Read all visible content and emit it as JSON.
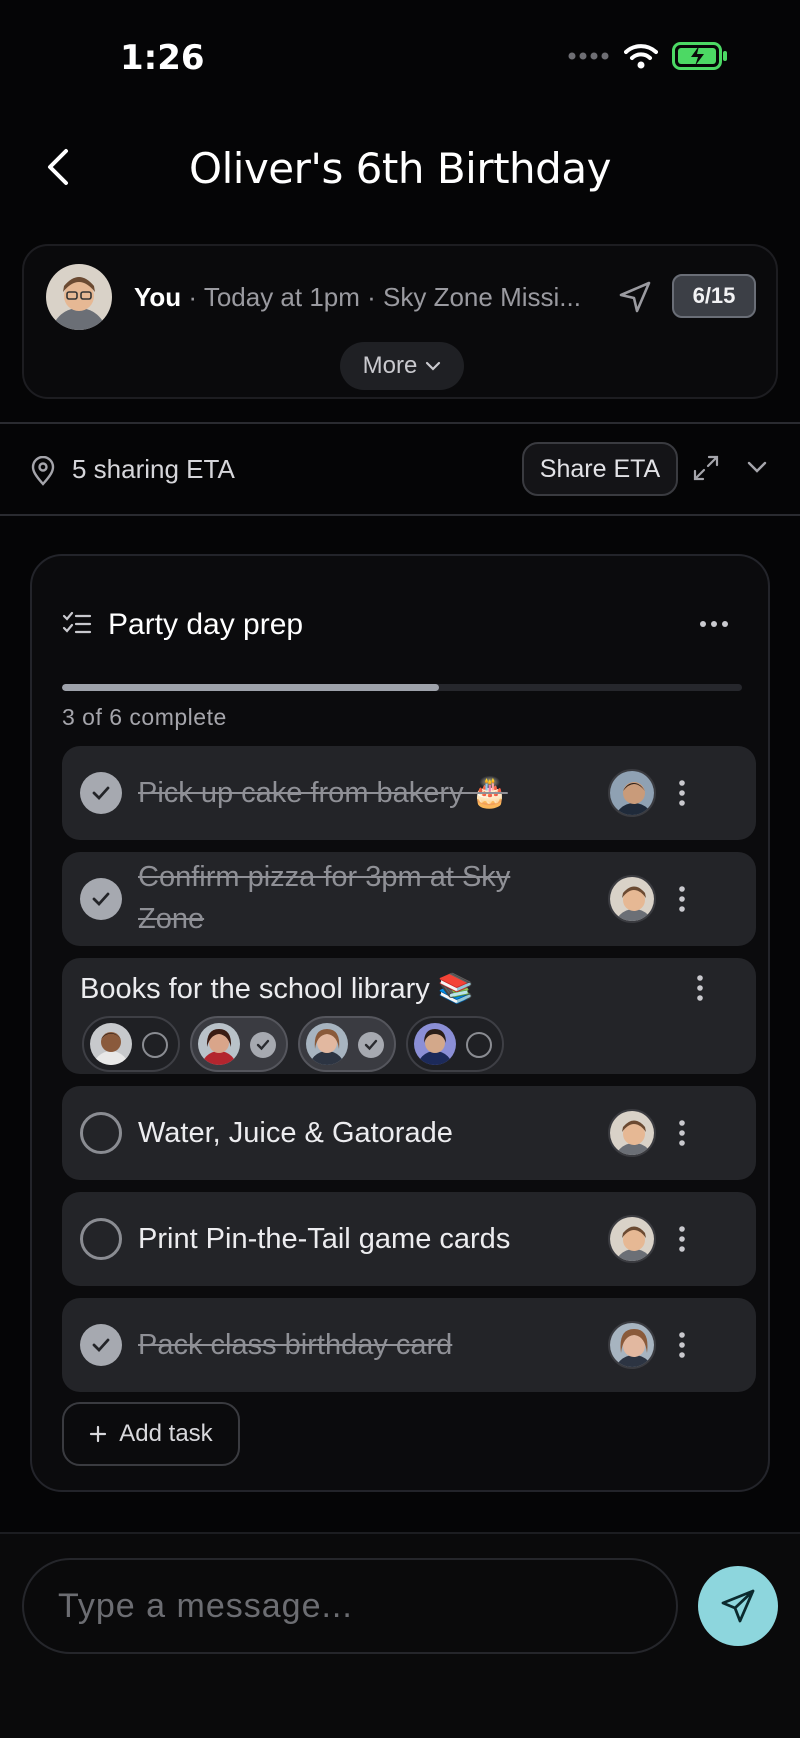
{
  "status": {
    "time": "1:26"
  },
  "header": {
    "title": "Oliver's 6th Birthday"
  },
  "event": {
    "who": "You",
    "details": " · Today at 1pm · Sky Zone Missi...",
    "count": "6/15",
    "more_label": "More"
  },
  "eta": {
    "label": "5 sharing ETA",
    "share_label": "Share ETA"
  },
  "checklist": {
    "title": "Party day prep",
    "progress_label": "3 of 6 complete",
    "progress_fraction": 0.555,
    "tasks": [
      {
        "text": "Pick up cake from bakery 🎂",
        "done": true
      },
      {
        "text": "Confirm pizza for 3pm at Sky Zone",
        "done": true
      },
      {
        "text": "Books for the school library 📚",
        "done": false
      },
      {
        "text": "Water, Juice & Gatorade",
        "done": false
      },
      {
        "text": "Print Pin-the-Tail game cards",
        "done": false
      },
      {
        "text": "Pack class birthday card",
        "done": true
      }
    ],
    "add_label": "Add task"
  },
  "composer": {
    "placeholder": "Type a message..."
  },
  "colors": {
    "accent": "#8dd6dd",
    "battery": "#4cd964"
  }
}
